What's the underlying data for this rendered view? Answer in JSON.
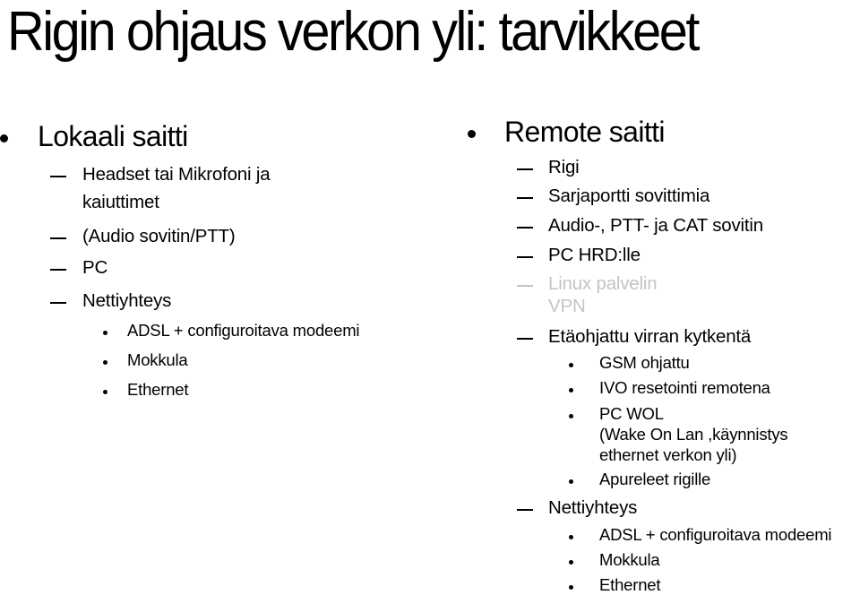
{
  "slide": {
    "title": "Rigin ohjaus verkon yli: tarvikkeet",
    "muted_color": "#c4c4c4",
    "left": {
      "heading": "Lokaali saitti",
      "items": [
        {
          "text": "Headset tai Mikrofoni ja",
          "continuation": "kaiuttimet"
        },
        {
          "text": "(Audio sovitin/PTT)"
        },
        {
          "text": "PC"
        },
        {
          "text": "Nettiyhteys",
          "subitems": [
            "ADSL + configuroitava modeemi",
            "Mokkula",
            "Ethernet"
          ]
        }
      ]
    },
    "right": {
      "heading": "Remote saitti",
      "items": [
        {
          "text": "Rigi"
        },
        {
          "text": "Sarjaportti sovittimia"
        },
        {
          "text": "Audio-,  PTT- ja CAT sovitin"
        },
        {
          "text": "PC HRD:lle"
        },
        {
          "text": "Linux palvelin",
          "continuation": "VPN",
          "muted": true
        },
        {
          "text": "Etäohjattu virran kytkentä",
          "subitems": [
            {
              "text": "GSM ohjattu"
            },
            {
              "text": "IVO resetointi remotena"
            },
            {
              "text": "PC WOL",
              "continuation": [
                "(Wake On Lan ,käynnistys",
                "ethernet verkon yli)"
              ]
            },
            {
              "text": "Apureleet rigille"
            }
          ]
        },
        {
          "text": "Nettiyhteys",
          "subitems": [
            "ADSL + configuroitava modeemi",
            "Mokkula",
            "Ethernet"
          ]
        }
      ]
    }
  }
}
